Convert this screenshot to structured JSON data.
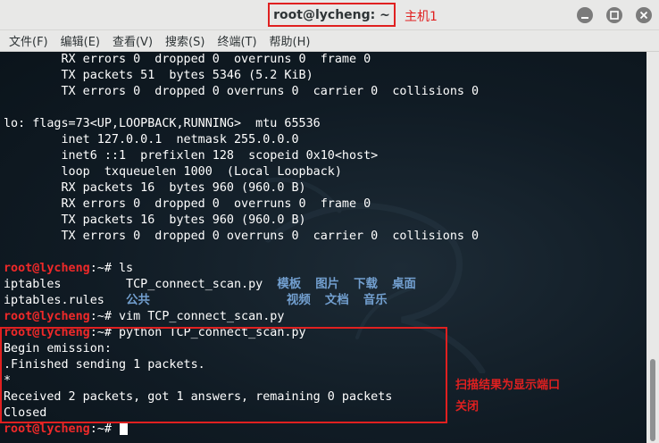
{
  "window": {
    "title": "root@lycheng: ~",
    "title_annotation": "主机1",
    "minimize_icon": "minimize-icon",
    "maximize_icon": "maximize-icon",
    "close_icon": "close-icon"
  },
  "menu": [
    "文件(F)",
    "编辑(E)",
    "查看(V)",
    "搜索(S)",
    "终端(T)",
    "帮助(H)"
  ],
  "terminal": {
    "lines": [
      "        RX errors 0  dropped 0  overruns 0  frame 0",
      "        TX packets 51  bytes 5346 (5.2 KiB)",
      "        TX errors 0  dropped 0 overruns 0  carrier 0  collisions 0",
      "",
      "lo: flags=73<UP,LOOPBACK,RUNNING>  mtu 65536",
      "        inet 127.0.0.1  netmask 255.0.0.0",
      "        inet6 ::1  prefixlen 128  scopeid 0x10<host>",
      "        loop  txqueuelen 1000  (Local Loopback)",
      "        RX packets 16  bytes 960 (960.0 B)",
      "        RX errors 0  dropped 0  overruns 0  frame 0",
      "        TX packets 16  bytes 960 (960.0 B)",
      "        TX errors 0  dropped 0 overruns 0  carrier 0  collisions 0"
    ],
    "prompt": "root@lycheng",
    "prompt_suffix": ":~# ",
    "cmd_ls": "ls",
    "ls_row1_files": "iptables         TCP_connect_scan.py  ",
    "ls_row1_dirs": "模板  图片  下载  桌面",
    "ls_row2_files": "iptables.rules   ",
    "ls_row2_dirs": "公共                   视频  文档  音乐",
    "cmd_vim": "vim TCP_connect_scan.py",
    "cmd_python": "python TCP_connect_scan.py",
    "output": [
      "Begin emission:",
      ".Finished sending 1 packets.",
      "*",
      "Received 2 packets, got 1 answers, remaining 0 packets",
      "Closed"
    ]
  },
  "annotations": {
    "result_note_line1": "扫描结果为显示端口",
    "result_note_line2": "关闭"
  },
  "colors": {
    "prompt": "#ef2929",
    "directory": "#729fcf",
    "annotation": "#e02020"
  }
}
